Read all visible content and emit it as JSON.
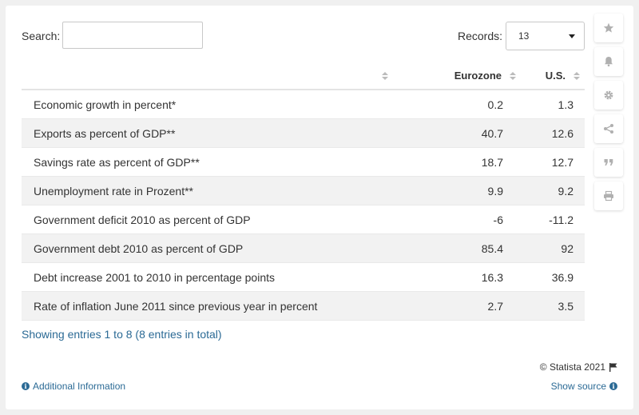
{
  "search": {
    "label": "Search:",
    "value": "",
    "placeholder": ""
  },
  "records": {
    "label": "Records:",
    "value": "13"
  },
  "table": {
    "columns": [
      "",
      "Eurozone",
      "U.S."
    ],
    "rows": [
      {
        "label": "Economic growth in percent*",
        "eurozone": "0.2",
        "us": "1.3"
      },
      {
        "label": "Exports as percent of GDP**",
        "eurozone": "40.7",
        "us": "12.6"
      },
      {
        "label": "Savings rate as percent of GDP**",
        "eurozone": "18.7",
        "us": "12.7"
      },
      {
        "label": "Unemployment rate in Prozent**",
        "eurozone": "9.9",
        "us": "9.2"
      },
      {
        "label": "Government deficit 2010 as percent of GDP",
        "eurozone": "-6",
        "us": "-11.2"
      },
      {
        "label": "Government debt 2010 as percent of GDP",
        "eurozone": "85.4",
        "us": "92"
      },
      {
        "label": "Debt increase 2001 to 2010 in percentage points",
        "eurozone": "16.3",
        "us": "36.9"
      },
      {
        "label": "Rate of inflation June 2011 since previous year in percent",
        "eurozone": "2.7",
        "us": "3.5"
      }
    ]
  },
  "footer": {
    "entries": "Showing entries 1 to 8 (8 entries in total)",
    "copyright": "© Statista 2021",
    "additional_info": "Additional Information",
    "show_source": "Show source"
  },
  "sidebar_tools": [
    "star-icon",
    "bell-icon",
    "gear-icon",
    "share-icon",
    "quote-icon",
    "print-icon"
  ],
  "colors": {
    "link": "#2b6a95",
    "row_alt": "#f2f2f2",
    "icon": "#b0b0b0"
  }
}
